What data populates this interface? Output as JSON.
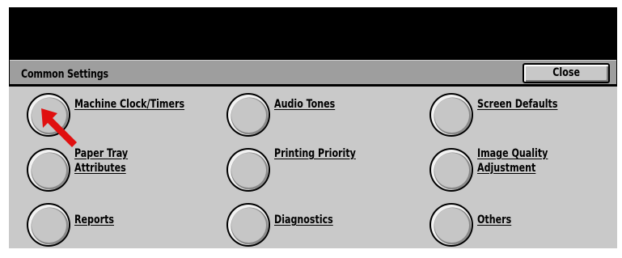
{
  "header": {
    "title": "Common Settings",
    "close_label": "Close"
  },
  "options": {
    "machine_clock": {
      "label": "Machine Clock/Timers"
    },
    "audio_tones": {
      "label": "Audio Tones"
    },
    "screen_defaults": {
      "label": "Screen Defaults"
    },
    "paper_tray": {
      "line1": "Paper Tray",
      "line2": "Attributes"
    },
    "printing_priority": {
      "label": "Printing Priority"
    },
    "image_quality": {
      "line1": "Image Quality",
      "line2": "Adjustment"
    },
    "reports": {
      "label": "Reports"
    },
    "diagnostics": {
      "label": "Diagnostics"
    },
    "others": {
      "label": "Others"
    }
  },
  "colors": {
    "header_gray": "#9e9e9e",
    "panel_gray": "#c9c9c9",
    "pointer_red": "#e01010"
  },
  "icons": {
    "radio": "circular-radio-button",
    "pointer": "red-arrow-pointer"
  }
}
